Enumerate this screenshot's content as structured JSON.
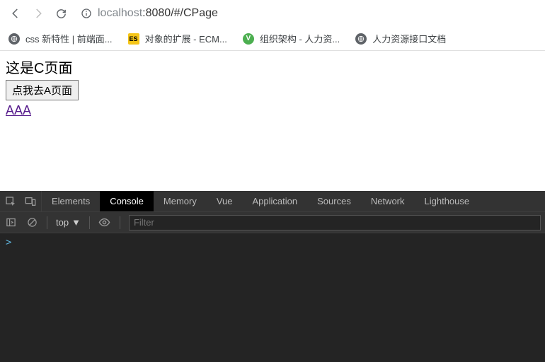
{
  "nav": {
    "url_muted_prefix": "localhost",
    "url_rest": ":8080/#/CPage"
  },
  "bookmarks": [
    {
      "label": "css 新特性 | 前端面...",
      "iconType": "globe",
      "iconText": ""
    },
    {
      "label": "对象的扩展 - ECM...",
      "iconType": "es",
      "iconText": "ES"
    },
    {
      "label": "组织架构 - 人力资...",
      "iconType": "v",
      "iconText": "V"
    },
    {
      "label": "人力资源接口文档",
      "iconType": "globe",
      "iconText": ""
    }
  ],
  "page": {
    "heading": "这是C页面",
    "button_label": "点我去A页面",
    "link_label": "AAA"
  },
  "devtools": {
    "tabs": [
      "Elements",
      "Console",
      "Memory",
      "Vue",
      "Application",
      "Sources",
      "Network",
      "Lighthouse"
    ],
    "active_tab": "Console",
    "context": "top",
    "filter_placeholder": "Filter",
    "prompt": ">"
  }
}
